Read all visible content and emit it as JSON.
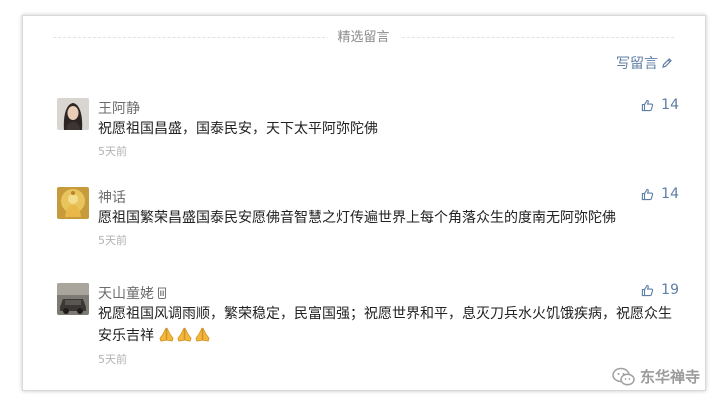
{
  "section": {
    "title": "精选留言",
    "write_label": "写留言"
  },
  "comments": [
    {
      "nickname": "王阿静",
      "text": "祝愿祖国昌盛，国泰民安，天下太平阿弥陀佛",
      "time": "5天前",
      "likes": "14",
      "avatar_icon": "avatar-woman-photo"
    },
    {
      "nickname": "神话",
      "text": "愿祖国繁荣昌盛国泰民安愿佛音智慧之灯传遍世界上每个角落众生的度南无阿弥陀佛",
      "time": "5天前",
      "likes": "14",
      "avatar_icon": "avatar-buddha-photo"
    },
    {
      "nickname": "天山童姥",
      "text": "祝愿祖国风调雨顺，繁荣稳定，民富国强；祝愿世界和平，息灭刀兵水火饥饿疾病，祝愿众生安乐吉祥",
      "time": "5天前",
      "likes": "19",
      "avatar_icon": "avatar-car-photo",
      "emoji": [
        "folded-hands",
        "folded-hands",
        "folded-hands"
      ]
    }
  ],
  "watermark": {
    "text": "东华禅寺"
  },
  "colors": {
    "link": "#607fa6",
    "like": "#5d7ea5",
    "text": "#222222",
    "muted": "#b2b2b2"
  }
}
